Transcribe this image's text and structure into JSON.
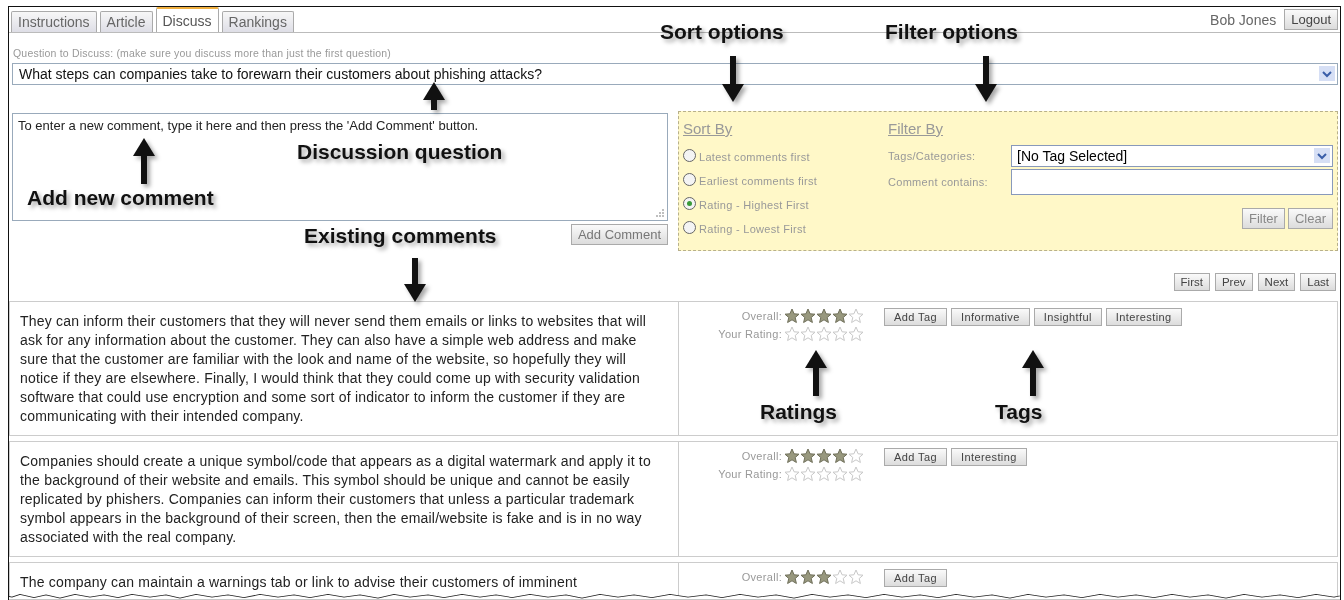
{
  "tabs": [
    {
      "label": "Instructions",
      "selected": false
    },
    {
      "label": "Article",
      "selected": false
    },
    {
      "label": "Discuss",
      "selected": true
    },
    {
      "label": "Rankings",
      "selected": false
    }
  ],
  "user": {
    "name": "Bob Jones",
    "logout": "Logout"
  },
  "question": {
    "label": "Question to Discuss: (make sure you discuss more than just the first question)",
    "value": "What steps can companies take to forewarn their customers about phishing attacks?"
  },
  "new_comment": {
    "value": "To enter a new comment, type it here and then press the 'Add Comment' button.",
    "button": "Add Comment"
  },
  "sort": {
    "title": "Sort By",
    "options": [
      {
        "label": "Latest comments first",
        "selected": false
      },
      {
        "label": "Earliest comments first",
        "selected": false
      },
      {
        "label": "Rating - Highest First",
        "selected": true
      },
      {
        "label": "Rating - Lowest First",
        "selected": false
      }
    ]
  },
  "filter": {
    "title": "Filter By",
    "tags_label": "Tags/Categories:",
    "tags_value": "[No Tag Selected]",
    "contains_label": "Comment contains:",
    "buttons": [
      "Filter",
      "Clear"
    ]
  },
  "pagination": [
    "First",
    "Prev",
    "Next",
    "Last"
  ],
  "comments": [
    {
      "text": "They can inform their customers that they will never send them emails or links to websites that will ask for any information about the customer. They can also have a simple web address and make sure that the customer are familiar with the look and name of the website, so hopefully they will notice if they are elsewhere. Finally, I would think that they could come up with security validation software that could use encryption and some sort of indicator to inform the customer if they are communicating with their intended company.",
      "overall": {
        "label": "Overall:",
        "stars": 4
      },
      "your_rating": {
        "label": "Your Rating:",
        "stars": 0
      },
      "add_tag": "Add Tag",
      "tags": [
        "Informative",
        "Insightful",
        "Interesting"
      ]
    },
    {
      "text": "Companies should create a unique symbol/code that appears as a digital watermark and apply it to the background of their website and emails. This symbol should be unique and cannot be easily replicated by phishers. Companies can inform their customers that unless a particular trademark symbol appears in the background of their screen, then the email/website is fake and is in no way associated with the real company.",
      "overall": {
        "label": "Overall:",
        "stars": 4
      },
      "your_rating": {
        "label": "Your Rating:",
        "stars": 0
      },
      "add_tag": "Add Tag",
      "tags": [
        "Interesting"
      ]
    },
    {
      "text": "The company can maintain a warnings tab or link to advise their customers of imminent",
      "overall": {
        "label": "Overall:",
        "stars": 3
      },
      "add_tag": "Add Tag"
    }
  ],
  "annotations": [
    {
      "label": "Sort options"
    },
    {
      "label": "Filter options"
    },
    {
      "label": "Discussion question"
    },
    {
      "label": "Add new comment"
    },
    {
      "label": "Existing comments"
    },
    {
      "label": "Ratings"
    },
    {
      "label": "Tags"
    }
  ]
}
